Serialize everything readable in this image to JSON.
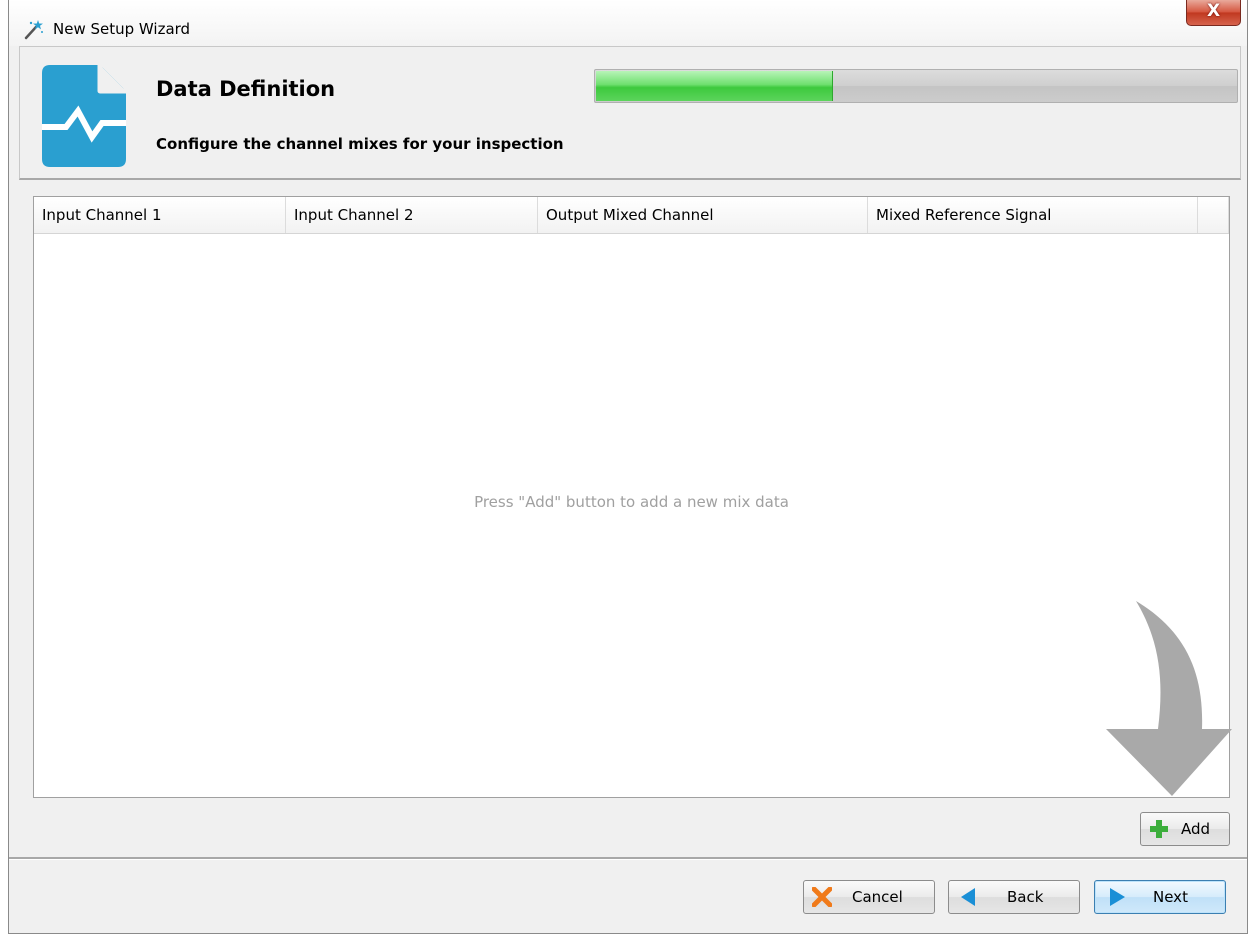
{
  "window": {
    "title": "New Setup Wizard",
    "close_label": "X"
  },
  "header": {
    "title": "Data Definition",
    "subtitle": "Configure the channel mixes for your inspection",
    "progress_fraction": 0.37
  },
  "table": {
    "columns": [
      "Input Channel 1",
      "Input Channel 2",
      "Output Mixed Channel",
      "Mixed Reference Signal",
      ""
    ],
    "rows": [],
    "empty_message": "Press \"Add\" button to add a new mix data"
  },
  "buttons": {
    "add": "Add",
    "cancel": "Cancel",
    "back": "Back",
    "next": "Next"
  },
  "colors": {
    "brand_blue": "#2a9fd0",
    "progress_green": "#3dc93d",
    "cancel_orange": "#f07a1a",
    "nav_blue": "#1a8fd6",
    "add_green": "#3cae3c"
  },
  "icons": {
    "title": "magic-wand-icon",
    "header": "data-waveform-document-icon",
    "hint": "curved-arrow-down-icon",
    "add": "plus-icon",
    "cancel": "x-icon",
    "back": "triangle-left-icon",
    "next": "triangle-right-icon"
  }
}
